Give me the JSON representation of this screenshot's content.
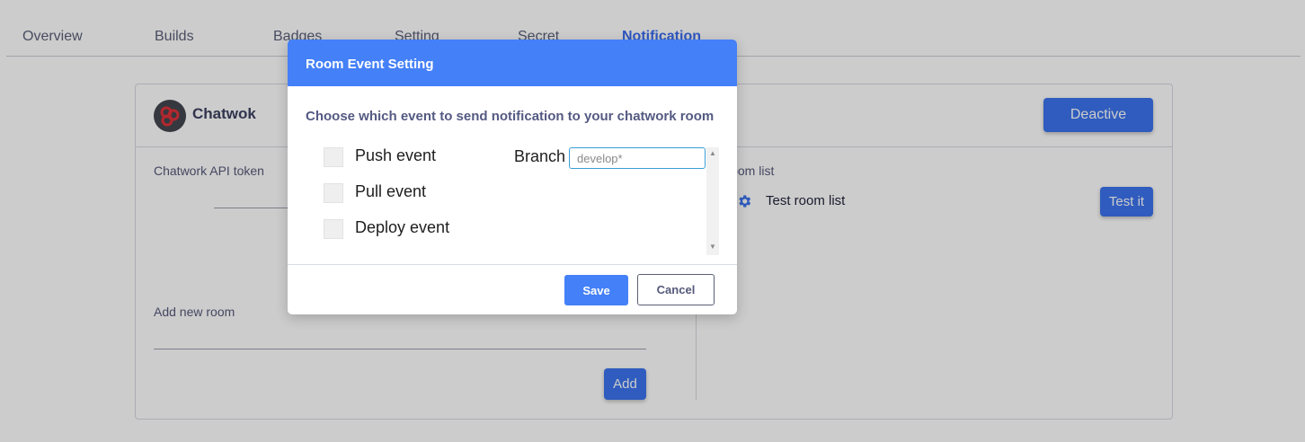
{
  "tabs": [
    {
      "label": "Overview",
      "active": false
    },
    {
      "label": "Builds",
      "active": false
    },
    {
      "label": "Badges",
      "active": false
    },
    {
      "label": "Setting",
      "active": false
    },
    {
      "label": "Secret",
      "active": false
    },
    {
      "label": "Notification",
      "active": true
    }
  ],
  "integration": {
    "name": "Chatwok",
    "logo_icon": "chatwork-logo-icon",
    "deactive_label": "Deactive",
    "api_token_label": "Chatwork API token",
    "add_room_label": "Add new room",
    "add_label": "Add",
    "room_list_label": "Room list",
    "rooms": [
      {
        "name": "Test room list",
        "icon": "gear-icon",
        "test_label": "Test it"
      }
    ]
  },
  "modal": {
    "title": "Room Event Setting",
    "description": "Choose which event to send notification to your chatwork room",
    "events": [
      {
        "label": "Push event",
        "checked": false
      },
      {
        "label": "Pull event",
        "checked": false
      },
      {
        "label": "Deploy event",
        "checked": false
      }
    ],
    "branch_label": "Branch",
    "branch_placeholder": "develop*",
    "save_label": "Save",
    "cancel_label": "Cancel"
  },
  "colors": {
    "accent": "#3b73ee",
    "modal_header": "#4480f7",
    "overlay": "rgba(0,0,0,0.2)"
  }
}
